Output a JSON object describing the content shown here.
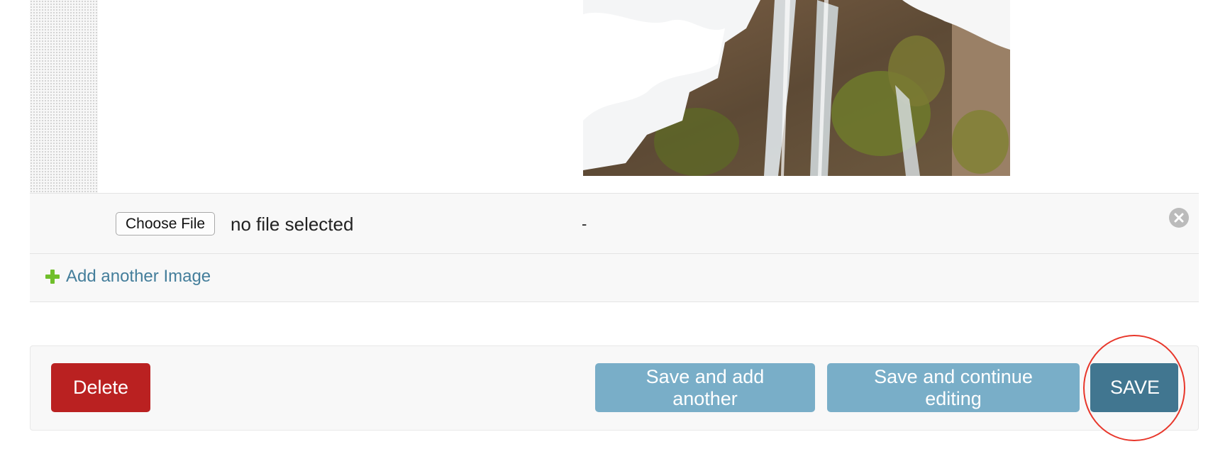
{
  "inline_image": {
    "thumbnail_alt": "snowy waterfall"
  },
  "file_row": {
    "choose_file_label": "Choose File",
    "file_status": "no file selected",
    "value": "-"
  },
  "add_row": {
    "label": "Add another Image"
  },
  "submit_row": {
    "delete_label": "Delete",
    "save_add_label": "Save and add another",
    "save_continue_label": "Save and continue editing",
    "save_label": "SAVE"
  },
  "colors": {
    "delete": "#ba2121",
    "secondary_button": "#79aec8",
    "primary_button": "#417690",
    "link": "#447e9b",
    "add_icon": "#70bf2b",
    "annotation_circle": "#e8372b"
  }
}
